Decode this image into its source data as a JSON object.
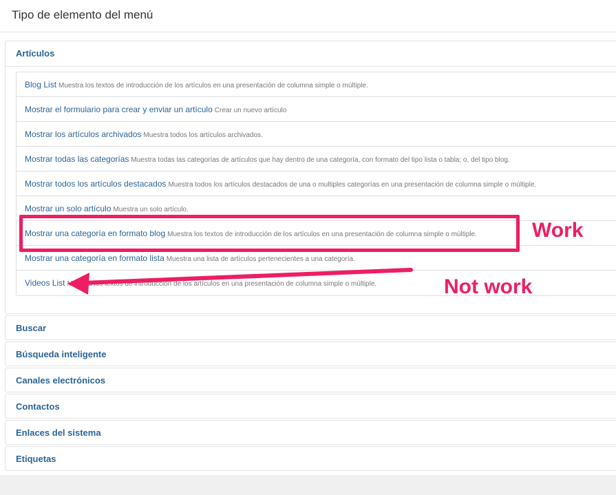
{
  "modal": {
    "title": "Tipo de elemento del menú"
  },
  "articulos": {
    "label": "Artículos",
    "items": [
      {
        "title": "Blog List",
        "desc": "Muestra los textos de introducción de los artículos en una presentación de columna simple o múltiple."
      },
      {
        "title": "Mostrar el formulario para crear y enviar un artículo",
        "desc": "Crear un nuevo artículo"
      },
      {
        "title": "Mostrar los artículos archivados",
        "desc": "Muestra todos los artículos archivados."
      },
      {
        "title": "Mostrar todas las categorías",
        "desc": "Muestra todas las categorías de artículos que hay dentro de una categoría, con formato del tipo lista o tabla; o, del tipo blog."
      },
      {
        "title": "Mostrar todos los artículos destacados",
        "desc": "Muestra todos los artículos destacados de una o multiples categorías en una presentación de columna simple o múltiple."
      },
      {
        "title": "Mostrar un solo artículo",
        "desc": "Muestra un solo artículo."
      },
      {
        "title": "Mostrar una categoría en formato blog",
        "desc": "Muestra los textos de introducción de los artículos en una presentación de columna simple o múltiple."
      },
      {
        "title": "Mostrar una categoría en formato lista",
        "desc": "Muestra una lista de artículos pertenecientes a una categoría."
      },
      {
        "title": "Videos List",
        "desc": "Muestra los textos de introducción de los artículos en una presentación de columna simple o múltiple."
      }
    ]
  },
  "sections": [
    {
      "label": "Buscar"
    },
    {
      "label": "Búsqueda inteligente"
    },
    {
      "label": "Canales electrónicos"
    },
    {
      "label": "Contactos"
    },
    {
      "label": "Enlaces del sistema"
    },
    {
      "label": "Etiquetas"
    }
  ],
  "annotations": {
    "work": "Work",
    "not_work": "Not work",
    "color": "#ee1d64"
  }
}
